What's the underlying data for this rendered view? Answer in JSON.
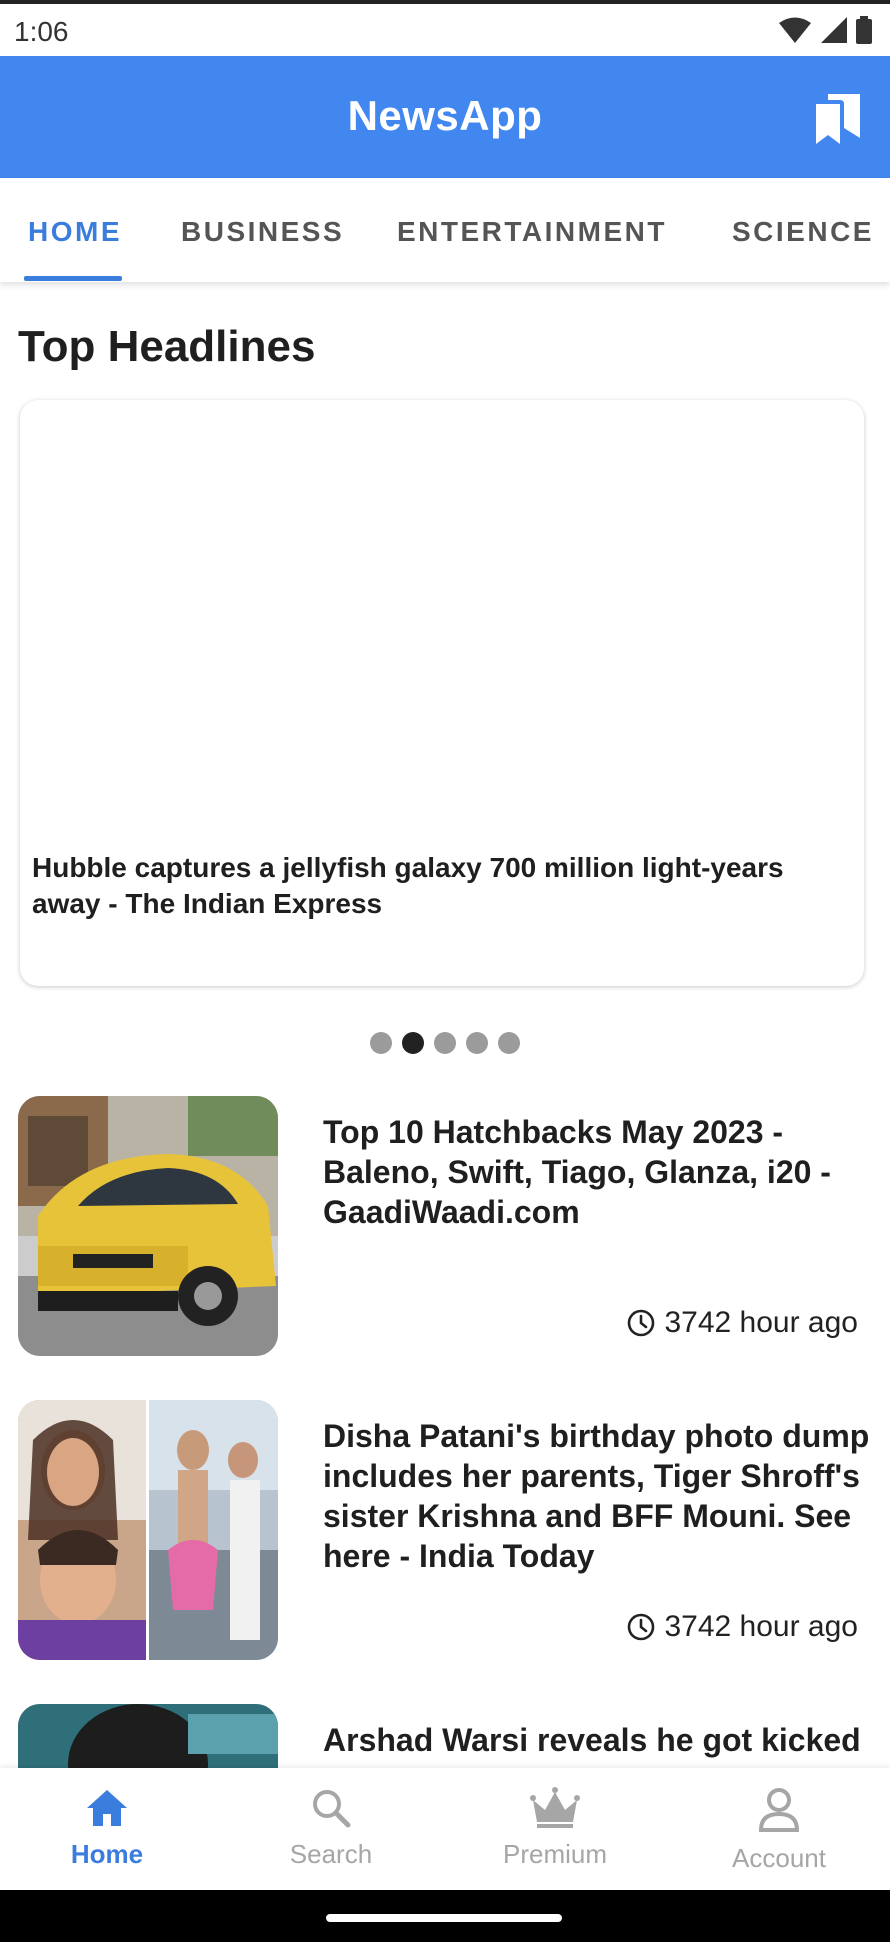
{
  "status_bar": {
    "time": "1:06"
  },
  "app_bar": {
    "title": "NewsApp"
  },
  "tabs": [
    {
      "label": "HOME",
      "active": true
    },
    {
      "label": "BUSINESS",
      "active": false
    },
    {
      "label": "ENTERTAINMENT",
      "active": false
    },
    {
      "label": "SCIENCE",
      "active": false
    }
  ],
  "section": {
    "title": "Top Headlines"
  },
  "carousel": {
    "headline": "Hubble captures a jellyfish galaxy 700 million light-years away - The Indian Express",
    "page_count": 5,
    "active_page": 2
  },
  "news": [
    {
      "title": "Top 10 Hatchbacks May 2023 - Baleno, Swift, Tiago, Glanza, i20 - GaadiWaadi.com",
      "time": "3742 hour ago"
    },
    {
      "title": "Disha Patani's birthday photo dump includes her parents, Tiger Shroff's sister Krishna and BFF Mouni. See here - India Today",
      "time": "3742 hour ago"
    },
    {
      "title": "Arshad Warsi reveals he got kicked",
      "time": ""
    }
  ],
  "bottom_nav": [
    {
      "label": "Home",
      "icon": "home-icon",
      "active": true
    },
    {
      "label": "Search",
      "icon": "search-icon",
      "active": false
    },
    {
      "label": "Premium",
      "icon": "crown-icon",
      "active": false
    },
    {
      "label": "Account",
      "icon": "account-icon",
      "active": false
    }
  ],
  "colors": {
    "primary": "#4287f0",
    "tab_active": "#3b7ddd",
    "inactive": "#a6a6a6"
  }
}
